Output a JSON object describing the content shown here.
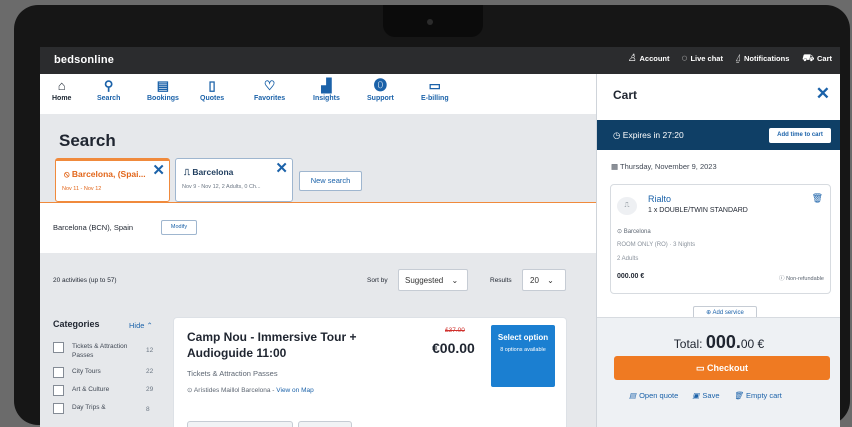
{
  "topbar": {
    "logo": "bedsonline",
    "links": [
      {
        "icon": "user-icon",
        "label": "Account"
      },
      {
        "icon": "chat-icon",
        "label": "Live chat"
      },
      {
        "icon": "bell-icon",
        "label": "Notifications"
      },
      {
        "icon": "cart-icon",
        "label": "Cart"
      }
    ]
  },
  "nav": [
    {
      "icon": "home-icon",
      "label": "Home"
    },
    {
      "icon": "search-icon",
      "label": "Search"
    },
    {
      "icon": "bookings-icon",
      "label": "Bookings"
    },
    {
      "icon": "quotes-icon",
      "label": "Quotes"
    },
    {
      "icon": "heart-icon",
      "label": "Favorites"
    },
    {
      "icon": "insights-icon",
      "label": "Insights"
    },
    {
      "icon": "support-icon",
      "label": "Support"
    },
    {
      "icon": "ebilling-icon",
      "label": "E-billing"
    }
  ],
  "main": {
    "title": "Search",
    "tabs": [
      {
        "label": "Barcelona, (Spai...",
        "sub": "Nov 11 - Nov 12"
      },
      {
        "label": "Barcelona",
        "sub": "Nov 9 - Nov 12, 2 Adults, 0 Ch..."
      }
    ],
    "new_search": "New search",
    "location": "Barcelona (BCN), Spain",
    "modify": "Modify",
    "count": "20 activities (up to 57)",
    "sort_label": "Sort by",
    "sort_value": "Suggested",
    "results_label": "Results",
    "results_value": "20"
  },
  "categories": {
    "title": "Categories",
    "hide": "Hide",
    "items": [
      {
        "label": "Tickets & Attraction Passes",
        "count": "12"
      },
      {
        "label": "City Tours",
        "count": "22"
      },
      {
        "label": "Art & Culture",
        "count": "29"
      },
      {
        "label": "Day Trips &",
        "count": "8"
      }
    ]
  },
  "activity": {
    "title": "Camp Nou - Immersive Tour + Audioguide 11:00",
    "category": "Tickets & Attraction Passes",
    "address": "Arístides Maillol Barcelona - ",
    "map_link": "View on Map",
    "old_price": "£37.00",
    "price": "€00.00",
    "select": "Select option",
    "select_sub": "8 options available"
  },
  "cart": {
    "title": "Cart",
    "expires": "Expires in 27:20",
    "add_time": "Add time to cart",
    "date": "Thursday, November 9, 2023",
    "hotel_name": "Rialto",
    "room": "1 x DOUBLE/TWIN STANDARD",
    "hotel_location": "Barcelona",
    "board": "ROOM ONLY (RO) · 3 Nights",
    "guests": "2 Adults",
    "hotel_price": "000.00 €",
    "nonrefundable": "Non-refundable",
    "add_service": "Add service",
    "total_label": "Total:",
    "total_value": "000.",
    "total_cents": "00 €",
    "checkout": "Checkout",
    "open_quote": "Open quote",
    "save": "Save",
    "empty": "Empty cart"
  }
}
